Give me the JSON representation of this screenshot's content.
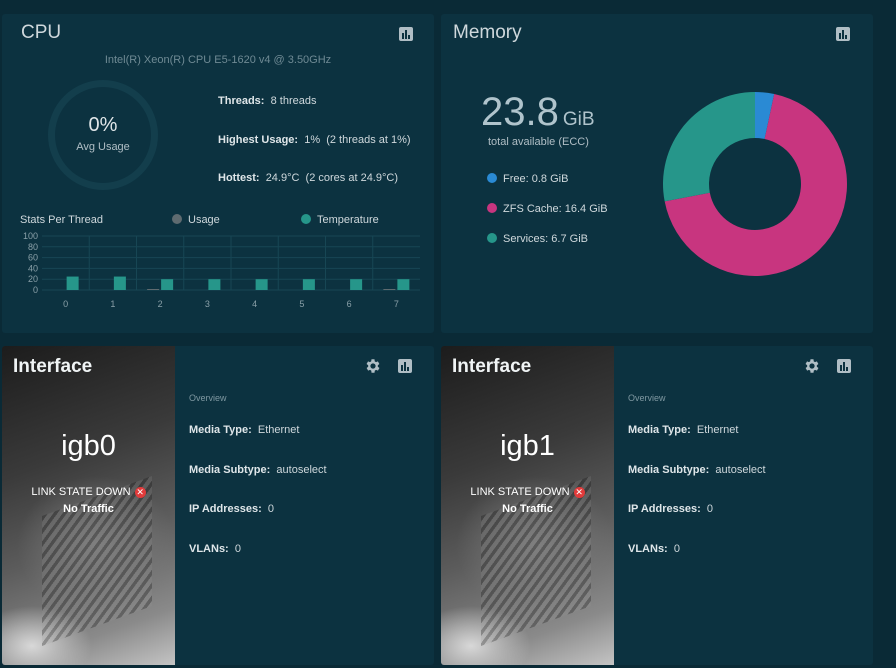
{
  "cpu": {
    "title": "CPU",
    "model": "Intel(R) Xeon(R) CPU E5-1620 v4 @ 3.50GHz",
    "avg_usage_pct": "0%",
    "avg_usage_label": "Avg Usage",
    "threads_label": "Threads:",
    "threads_value": "8 threads",
    "highest_label": "Highest Usage:",
    "highest_value": "1%  (2 threads at 1%)",
    "hottest_label": "Hottest:",
    "hottest_value": "24.9°C  (2 cores at 24.9°C)",
    "stats_title": "Stats Per Thread",
    "legend_usage": "Usage",
    "legend_temperature": "Temperature",
    "reports_icon": "bar-chart-icon"
  },
  "memory": {
    "title": "Memory",
    "total_value": "23.8",
    "total_unit": "GiB",
    "total_label": "total available (ECC)",
    "legend": [
      {
        "label": "Free: 0.8 GiB",
        "color": "#2a8ad4"
      },
      {
        "label": "ZFS Cache: 16.4 GiB",
        "color": "#c8357f"
      },
      {
        "label": "Services: 6.7 GiB",
        "color": "#26968a"
      }
    ],
    "reports_icon": "bar-chart-icon"
  },
  "chart_data": [
    {
      "type": "bar",
      "title": "Stats Per Thread",
      "categories": [
        "0",
        "1",
        "2",
        "3",
        "4",
        "5",
        "6",
        "7"
      ],
      "ylim": [
        0,
        100
      ],
      "yticks": [
        "100",
        "80",
        "60",
        "40",
        "20",
        "0"
      ],
      "series": [
        {
          "name": "Usage",
          "color": "#5f6b70",
          "values": [
            0,
            0,
            1,
            0,
            0,
            0,
            0,
            1
          ]
        },
        {
          "name": "Temperature",
          "color": "#26968a",
          "values": [
            24.9,
            24.9,
            20,
            20,
            20,
            20,
            20,
            20
          ]
        }
      ],
      "legend_position": "top"
    },
    {
      "type": "pie",
      "categories": [
        "Free",
        "ZFS Cache",
        "Services"
      ],
      "values": [
        0.8,
        16.4,
        6.7
      ],
      "colors": [
        "#2a8ad4",
        "#c8357f",
        "#26968a"
      ]
    }
  ],
  "interfaces": [
    {
      "title": "Interface",
      "name": "igb0",
      "link_state": "LINK STATE DOWN",
      "traffic": "No Traffic",
      "overview": "Overview",
      "media_type_label": "Media Type:",
      "media_type_value": "Ethernet",
      "media_subtype_label": "Media Subtype:",
      "media_subtype_value": "autoselect",
      "ip_label": "IP Addresses:",
      "ip_value": "0",
      "vlans_label": "VLANs:",
      "vlans_value": "0"
    },
    {
      "title": "Interface",
      "name": "igb1",
      "link_state": "LINK STATE DOWN",
      "traffic": "No Traffic",
      "overview": "Overview",
      "media_type_label": "Media Type:",
      "media_type_value": "Ethernet",
      "media_subtype_label": "Media Subtype:",
      "media_subtype_value": "autoselect",
      "ip_label": "IP Addresses:",
      "ip_value": "0",
      "vlans_label": "VLANs:",
      "vlans_value": "0"
    }
  ]
}
